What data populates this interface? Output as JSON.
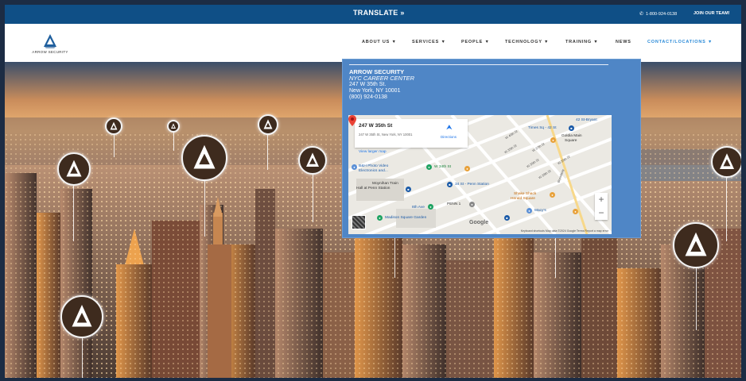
{
  "topbar": {
    "translate_label": "TRANSLATE »",
    "phone": "1-800-924-0138",
    "join_label": "JOIN OUR TEAM!"
  },
  "logo": {
    "text": "ARROW SECURITY"
  },
  "nav": {
    "items": [
      {
        "label": "ABOUT US ▼"
      },
      {
        "label": "SERVICES ▼"
      },
      {
        "label": "PEOPLE ▼"
      },
      {
        "label": "TECHNOLOGY ▼"
      },
      {
        "label": "TRAINING ▼"
      },
      {
        "label": "NEWS"
      },
      {
        "label": "CONTACT/LOCATIONS ▼"
      }
    ]
  },
  "location_card": {
    "company": "ARROW SECURITY",
    "center_name": "NYC CAREER CENTER",
    "street": "247 W 35th St.",
    "city": "New York, NY 10001",
    "phone": "(800) 924-0138"
  },
  "map": {
    "info_title": "247 W 35th St",
    "info_address": "247 W 35th St, New York, NY 10001",
    "directions_label": "Directions",
    "larger_map_label": "View larger map",
    "labels": {
      "bh": "B&H Photo Video",
      "bh2": "Electronics and...",
      "w34": "W 34th St",
      "moynihan": "Moynihan Train",
      "moynihan2": "Hall at Penn Station",
      "penn34": "34 St - Penn Station",
      "eighth": "8th Ave",
      "penn1": "PENN 1",
      "msg": "Madison Square Garden",
      "timessq": "Times Sq - 42 St",
      "w42": "42 St-Bryant",
      "goldia": "Goldia Main",
      "goldia2": "Square",
      "shakeshack": "Shake Shack",
      "shakeshack2": "Herald Square",
      "macys": "Macy's",
      "google": "Google"
    },
    "streets": [
      "W 35th St",
      "W 36th St",
      "W 37th St",
      "W 38th St",
      "W 39th St",
      "W 40th St",
      "Broadway"
    ],
    "zoom_in": "+",
    "zoom_out": "−",
    "footer": "Keyboard shortcuts   Map data ©2024 Google   Terms   Report a map error"
  },
  "colors": {
    "topbar": "#0f4f86",
    "card": "#4f86c6",
    "accent_nav": "#2a8ad8",
    "pin_badge": "#3e2b1e"
  },
  "icons": [
    "phone-icon",
    "directions-icon",
    "map-marker-icon",
    "arrow-logo-icon"
  ]
}
